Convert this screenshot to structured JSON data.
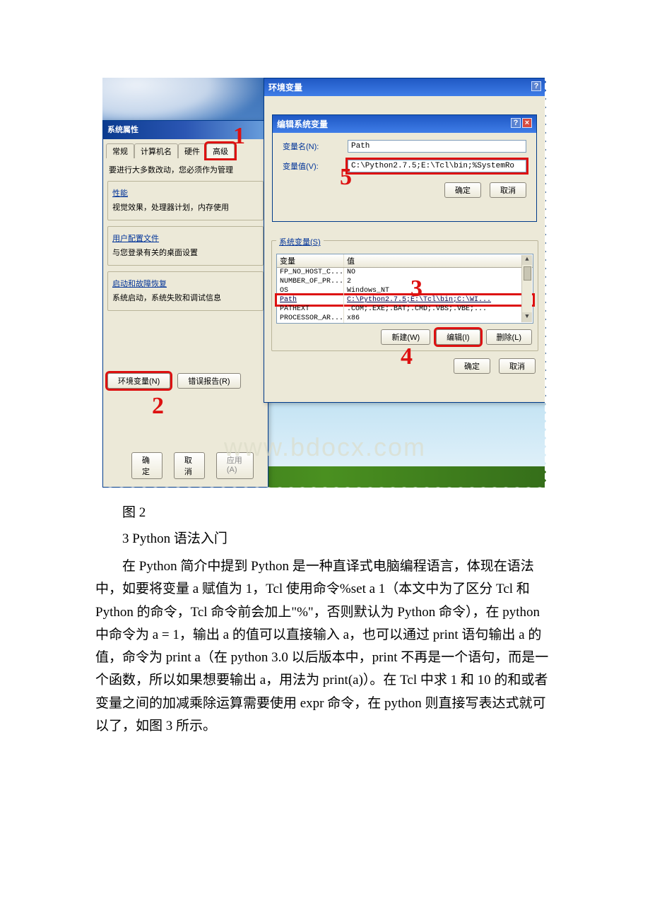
{
  "article": {
    "caption": "图 2",
    "section_title": "3 Python 语法入门",
    "paragraph": "在 Python 简介中提到 Python 是一种直译式电脑编程语言，体现在语法中，如要将变量 a 赋值为 1，Tcl 使用命令%set a 1（本文中为了区分 Tcl 和 Python 的命令，Tcl 命令前会加上\"%\"，否则默认为 Python 命令），在 python 中命令为 a = 1，输出 a 的值可以直接输入 a，也可以通过 print 语句输出 a 的值，命令为 print a（在 python 3.0 以后版本中，print 不再是一个语句，而是一个函数，所以如果想要输出 a，用法为 print(a)）。在 Tcl 中求 1 和 10 的和或者变量之间的加减乘除运算需要使用 expr 命令，在 python 则直接写表达式就可以了，如图 3 所示。"
  },
  "watermark": "www.bdocx.com",
  "sysprop": {
    "title": "系统属性",
    "tabs": {
      "general": "常规",
      "computer": "计算机名",
      "hardware": "硬件",
      "advanced": "高级"
    },
    "note": "要进行大多数改动，您必须作为管理",
    "perf": {
      "legend": "性能",
      "text": "视觉效果，处理器计划，内存使用"
    },
    "profile": {
      "legend": "用户配置文件",
      "text": "与您登录有关的桌面设置"
    },
    "startup": {
      "legend": "启动和故障恢复",
      "text": "系统启动，系统失败和调试信息"
    },
    "env_btn": "环境变量(N)",
    "err_btn": "错误报告(R)",
    "ok": "确定",
    "cancel": "取消",
    "apply": "应用(A)"
  },
  "envbig": {
    "title": "环境变量",
    "sys_legend": "系统变量(S)",
    "colvar": "变量",
    "colval": "值",
    "rows": [
      {
        "v": "FP_NO_HOST_C...",
        "d": "NO"
      },
      {
        "v": "NUMBER_OF_PR...",
        "d": "2"
      },
      {
        "v": "OS",
        "d": "Windows_NT"
      },
      {
        "v": "Path",
        "d": "C:\\Python2.7.5;E:\\Tcl\\bin;C:\\WI..."
      },
      {
        "v": "PATHEXT",
        "d": ".COM;.EXE;.BAT;.CMD;.VBS;.VBE;..."
      },
      {
        "v": "PROCESSOR_AR...",
        "d": "x86"
      }
    ],
    "new_btn": "新建(W)",
    "edit_btn": "编辑(I)",
    "del_btn": "删除(L)",
    "ok": "确定",
    "cancel": "取消"
  },
  "editdlg": {
    "title": "编辑系统变量",
    "name_label": "变量名(N):",
    "name_value": "Path",
    "val_label": "变量值(V):",
    "val_value": "C:\\Python2.7.5;E:\\Tcl\\bin;%SystemRo",
    "ok": "确定",
    "cancel": "取消"
  },
  "marks": {
    "m1": "1",
    "m2": "2",
    "m3": "3",
    "m4": "4",
    "m5": "5"
  }
}
